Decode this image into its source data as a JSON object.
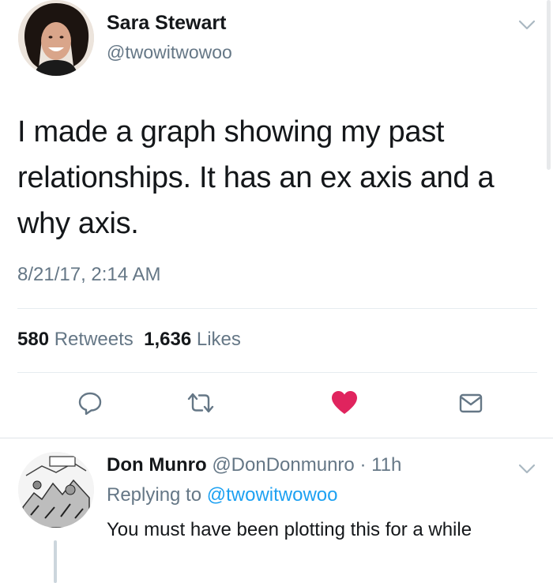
{
  "tweet": {
    "name": "Sara Stewart",
    "handle": "@twowitwowoo",
    "text": "I made a graph showing my past relationships. It has an ex axis and a why axis.",
    "timestamp": "8/21/17, 2:14 AM",
    "retweets_count": "580",
    "retweets_label": "Retweets",
    "likes_count": "1,636",
    "likes_label": "Likes"
  },
  "colors": {
    "like_active": "#e0245e",
    "link": "#1da1f2",
    "muted": "#657786"
  },
  "icons": [
    "reply-icon",
    "retweet-icon",
    "heart-icon",
    "message-icon",
    "chevron-down-icon"
  ],
  "reply": {
    "name": "Don Munro",
    "handle": "@DonDonmunro",
    "separator": "·",
    "time": "11h",
    "replying_prefix": "Replying to",
    "replying_to": "@twowitwowoo",
    "text": "You must have been plotting this for a while"
  }
}
